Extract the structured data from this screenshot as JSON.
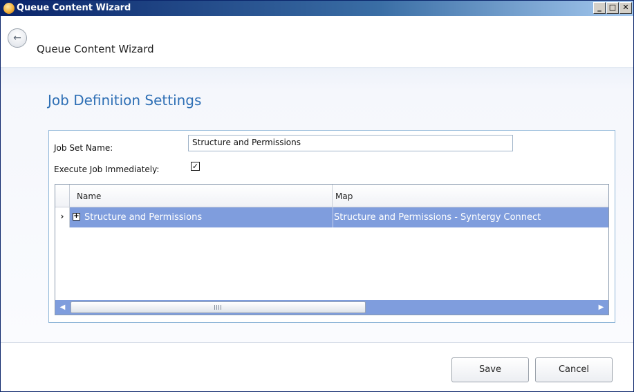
{
  "window": {
    "title": "Queue Content Wizard",
    "controls": {
      "minimize": "_",
      "maximize": "□",
      "close": "✕"
    }
  },
  "nav": {
    "back_icon": "←",
    "title": "Queue Content Wizard"
  },
  "main": {
    "section_title": "Job Definition Settings",
    "job_set_name_label": "Job Set Name:",
    "job_set_name_value": "Structure and Permissions",
    "execute_immediately_label": "Execute Job Immediately:",
    "execute_immediately_checked": true,
    "check_mark": "✓"
  },
  "grid": {
    "columns": [
      "Name",
      "Map"
    ],
    "rows": [
      {
        "indicator": "›",
        "expand": "+",
        "name": "Structure and Permissions",
        "map": "Structure and Permissions - Syntergy Connect"
      }
    ],
    "scroll_left": "◀",
    "scroll_right": "▶"
  },
  "footer": {
    "save_label": "Save",
    "cancel_label": "Cancel"
  },
  "colors": {
    "selected_row": "#7f9ddd",
    "section_title": "#2e6fb5",
    "titlebar": "#0a246a"
  }
}
